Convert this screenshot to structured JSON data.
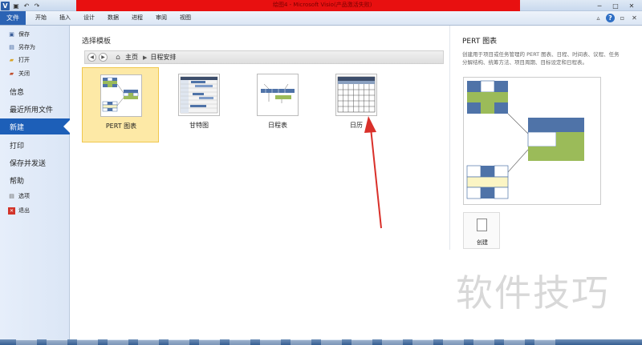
{
  "titlebar": {
    "title": "绘图4 - Microsoft Visio(产品激活失败)",
    "app_icon_letter": "V",
    "min": "─",
    "max": "□",
    "close": "✕",
    "undo": "↶",
    "redo": "↷",
    "save": "▣"
  },
  "ribbon": {
    "file": "文件",
    "tabs": [
      "开始",
      "插入",
      "设计",
      "数据",
      "进程",
      "审阅",
      "视图"
    ],
    "right_icons": {
      "minimize_ribbon": "▵",
      "help": "?",
      "restore": "▫",
      "close": "✕"
    }
  },
  "leftnav": {
    "save": "保存",
    "save_as": "另存为",
    "open": "打开",
    "close": "关闭",
    "info": "信息",
    "recent": "最近所用文件",
    "new": "新建",
    "print": "打印",
    "save_send": "保存并发送",
    "help": "帮助",
    "options": "选项",
    "exit": "退出"
  },
  "main": {
    "section_title": "选择模板",
    "breadcrumb": {
      "home": "主页",
      "current": "日程安排"
    },
    "templates": [
      {
        "label": "PERT 图表",
        "selected": true
      },
      {
        "label": "甘特图",
        "selected": false
      },
      {
        "label": "日程表",
        "selected": false
      },
      {
        "label": "日历",
        "selected": false
      }
    ]
  },
  "pane": {
    "title": "PERT 图表",
    "description": "创建用于项目或任务管理的 PERT 图表、日程、时间表、议程、任务分解结构、统筹方法、项目周期、目标设定和日程表。",
    "create_label": "创建"
  },
  "watermark": "软件技巧",
  "colors": {
    "accent_blue": "#1d5fb8",
    "title_red": "#e81010",
    "selected_tile": "#fde9a6",
    "pert_blue": "#4f73a8",
    "pert_green": "#9bbb59",
    "pert_yellow": "#fbf5c4"
  }
}
